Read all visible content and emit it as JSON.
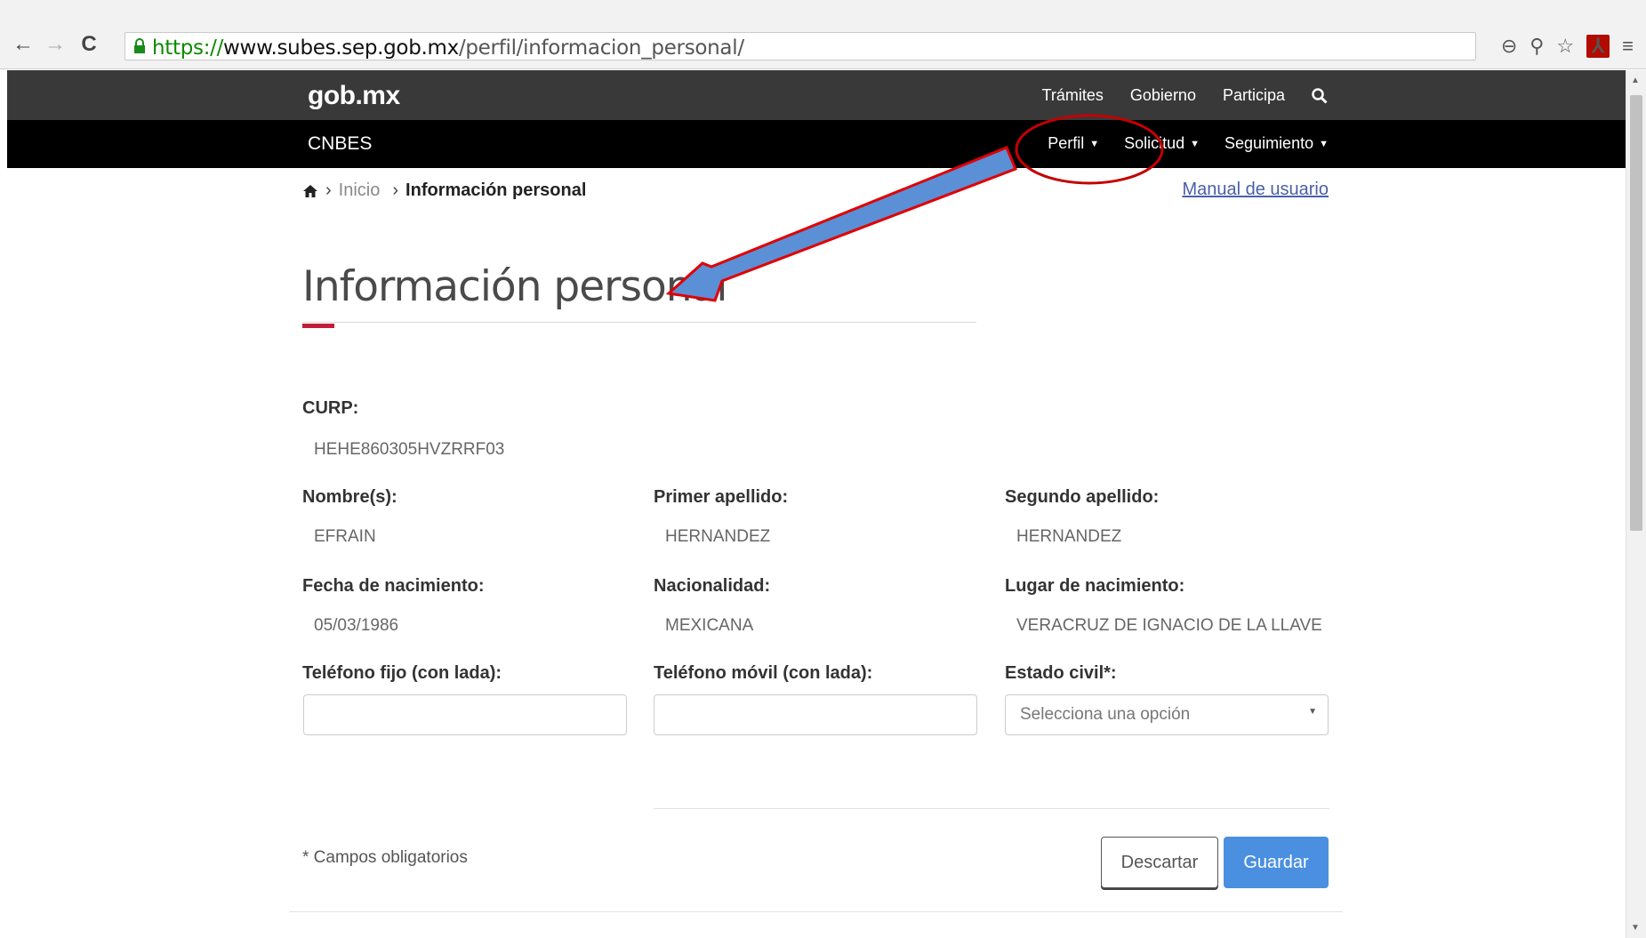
{
  "browser": {
    "url_scheme": "https://",
    "url_host": "www.subes.sep.gob.mx",
    "url_path": "/perfil/informacion_personal/"
  },
  "gob_header": {
    "logo": "gob.mx",
    "nav": [
      "Trámites",
      "Gobierno",
      "Participa"
    ]
  },
  "cnbes": {
    "title": "CNBES",
    "menu": [
      {
        "label": "Perfil"
      },
      {
        "label": "Solicitud"
      },
      {
        "label": "Seguimiento"
      }
    ]
  },
  "breadcrumb": {
    "home_link": "Inicio",
    "current": "Información personal"
  },
  "manual_link": "Manual de usuario",
  "page_title": "Información personal",
  "fields": {
    "curp": {
      "label": "CURP:",
      "value": "HEHE860305HVZRRF03"
    },
    "nombres": {
      "label": "Nombre(s):",
      "value": "EFRAIN"
    },
    "primer_apellido": {
      "label": "Primer apellido:",
      "value": "HERNANDEZ"
    },
    "segundo_apellido": {
      "label": "Segundo apellido:",
      "value": "HERNANDEZ"
    },
    "fecha_nacimiento": {
      "label": "Fecha de nacimiento:",
      "value": "05/03/1986"
    },
    "nacionalidad": {
      "label": "Nacionalidad:",
      "value": "MEXICANA"
    },
    "lugar_nacimiento": {
      "label": "Lugar de nacimiento:",
      "value": "VERACRUZ DE IGNACIO DE LA LLAVE"
    },
    "telefono_fijo": {
      "label": "Teléfono fijo (con lada):",
      "value": ""
    },
    "telefono_movil": {
      "label": "Teléfono móvil (con lada):",
      "value": ""
    },
    "estado_civil": {
      "label": "Estado civil*:",
      "placeholder": "Selecciona una opción"
    }
  },
  "required_note": "* Campos obligatorios",
  "buttons": {
    "discard": "Descartar",
    "save": "Guardar"
  },
  "colors": {
    "gob_bar": "#393939",
    "cnbes_bar": "#000000",
    "accent_red": "#c21d3a",
    "save_blue": "#4a8fe0",
    "annotation_arrow": "#5b8fd6",
    "annotation_outline": "#c40000"
  }
}
